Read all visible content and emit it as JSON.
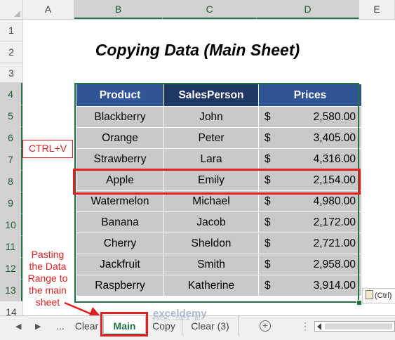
{
  "columns": [
    "A",
    "B",
    "C",
    "D",
    "E"
  ],
  "rows": [
    "1",
    "2",
    "3",
    "4",
    "5",
    "6",
    "7",
    "8",
    "9",
    "10",
    "11",
    "12",
    "13",
    "14"
  ],
  "title": "Copying Data (Main Sheet)",
  "table": {
    "headers": [
      "Product",
      "SalesPerson",
      "Prices"
    ],
    "rows": [
      {
        "product": "Blackberry",
        "salesperson": "John",
        "currency": "$",
        "price": "2,580.00"
      },
      {
        "product": "Orange",
        "salesperson": "Peter",
        "currency": "$",
        "price": "3,405.00"
      },
      {
        "product": "Strawberry",
        "salesperson": "Lara",
        "currency": "$",
        "price": "4,316.00"
      },
      {
        "product": "Apple",
        "salesperson": "Emily",
        "currency": "$",
        "price": "2,154.00"
      },
      {
        "product": "Watermelon",
        "salesperson": "Michael",
        "currency": "$",
        "price": "4,980.00"
      },
      {
        "product": "Banana",
        "salesperson": "Jacob",
        "currency": "$",
        "price": "2,172.00"
      },
      {
        "product": "Cherry",
        "salesperson": "Sheldon",
        "currency": "$",
        "price": "2,721.00"
      },
      {
        "product": "Jackfruit",
        "salesperson": "Smith",
        "currency": "$",
        "price": "2,958.00"
      },
      {
        "product": "Raspberry",
        "salesperson": "Katherine",
        "currency": "$",
        "price": "3,914.00"
      }
    ]
  },
  "annotations": {
    "ctrl_v": "CTRL+V",
    "note_lines": [
      "Pasting",
      "the Data",
      "Range to",
      "the main",
      "sheet"
    ]
  },
  "paste_options": {
    "label": "(Ctrl)"
  },
  "sheet_tabs": {
    "ellipsis": "...",
    "tabs": [
      "Clear",
      "Main",
      "Copy",
      "Clear (3)"
    ],
    "active": "Main",
    "add": "+",
    "more": "⋮"
  },
  "watermark": {
    "name": "exceldemy",
    "tagline": "EXCEL · DATA · BI"
  },
  "colors": {
    "header_blue": "#2f5597",
    "header_dark_blue": "#203864",
    "cell_gray": "#c9c9c9",
    "highlight_red": "#e02020",
    "excel_green": "#217346"
  }
}
